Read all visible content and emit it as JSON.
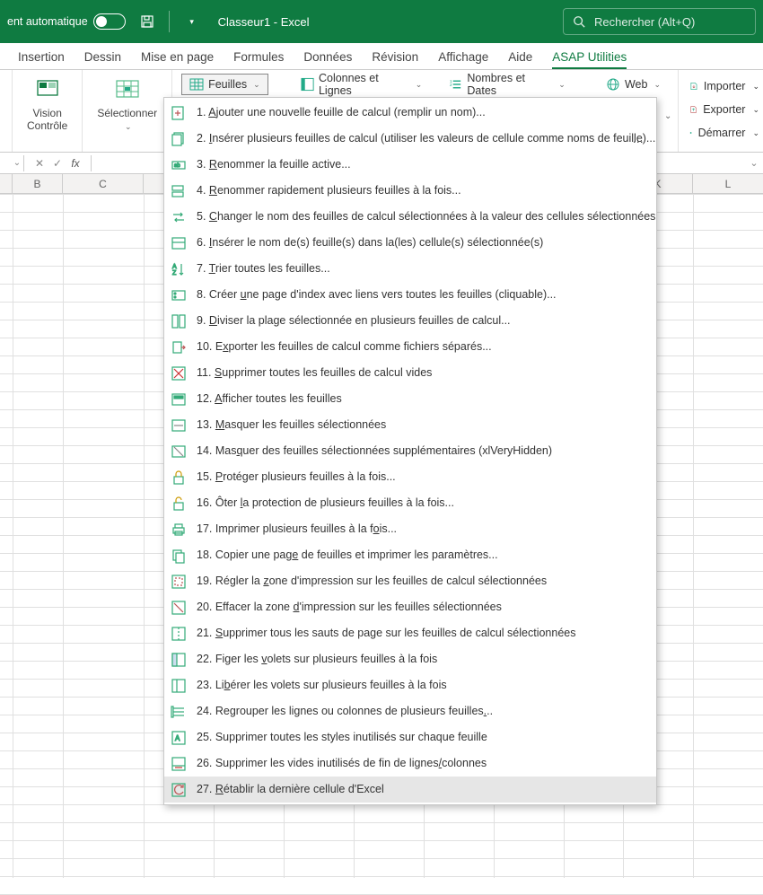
{
  "titlebar": {
    "autosave": "ent automatique",
    "doc_title": "Classeur1 - Excel",
    "search_placeholder": "Rechercher (Alt+Q)"
  },
  "tabs": [
    "Insertion",
    "Dessin",
    "Mise en page",
    "Formules",
    "Données",
    "Révision",
    "Affichage",
    "Aide",
    "ASAP Utilities"
  ],
  "active_tab": 8,
  "ribbon": {
    "vision": "Vision\nContrôle",
    "select": "Sélectionner",
    "feuilles": "Feuilles",
    "colonnes": "Colonnes et Lignes",
    "nombres": "Nombres et Dates",
    "web": "Web",
    "right": [
      {
        "icon": "import",
        "label": "Importer"
      },
      {
        "icon": "export",
        "label": "Exporter"
      },
      {
        "icon": "play",
        "label": "Démarrer"
      }
    ]
  },
  "columns": [
    "B",
    "C",
    "K",
    "L"
  ],
  "menu": {
    "hover_index": 26,
    "items": [
      {
        "icon": "sheet-plus",
        "n": "1",
        "u": "A",
        "pre": "",
        "post": "jouter une nouvelle feuille de calcul (remplir un nom)...",
        "ell": false
      },
      {
        "icon": "sheets",
        "n": "2",
        "u": "I",
        "pre": "",
        "post": "nsérer plusieurs feuilles de calcul (utiliser les valeurs de cellule comme noms de feuille)...",
        "ell": true
      },
      {
        "icon": "rename",
        "n": "3",
        "u": "R",
        "pre": "",
        "post": "enommer la feuille active..."
      },
      {
        "icon": "rename-all",
        "n": "4",
        "u": "R",
        "pre": "",
        "post": "enommer rapidement plusieurs feuilles à la fois..."
      },
      {
        "icon": "swap",
        "n": "5",
        "u": "C",
        "pre": "",
        "post": "hanger le nom des feuilles de calcul sélectionnées à la valeur des cellules sélectionnées"
      },
      {
        "icon": "insert-name",
        "n": "6",
        "u": "I",
        "pre": "",
        "post": "nsérer le nom de(s) feuille(s) dans la(les) cellule(s) sélectionnée(s)"
      },
      {
        "icon": "sort",
        "n": "7",
        "u": "T",
        "pre": "",
        "post": "rier toutes les feuilles..."
      },
      {
        "icon": "index",
        "n": "8",
        "u": "u",
        "pre": "Créer ",
        "post": "ne page d'index avec liens vers toutes les feuilles (cliquable)..."
      },
      {
        "icon": "split",
        "n": "9",
        "u": "D",
        "pre": "",
        "post": "iviser la plage sélectionnée en plusieurs feuilles de calcul..."
      },
      {
        "icon": "export-files",
        "n": "10",
        "u": "x",
        "pre": "E",
        "post": "porter les feuilles de calcul comme fichiers séparés..."
      },
      {
        "icon": "del-empty",
        "n": "11",
        "u": "S",
        "pre": "",
        "post": "upprimer toutes les feuilles de calcul vides"
      },
      {
        "icon": "show",
        "n": "12",
        "u": "A",
        "pre": "",
        "post": "fficher toutes les feuilles"
      },
      {
        "icon": "hide",
        "n": "13",
        "u": "M",
        "pre": "",
        "post": "asquer les feuilles sélectionnées"
      },
      {
        "icon": "veryhide",
        "n": "14",
        "u": "q",
        "pre": "Mas",
        "post": "uer des feuilles sélectionnées supplémentaires (xlVeryHidden)"
      },
      {
        "icon": "protect",
        "n": "15",
        "u": "P",
        "pre": "",
        "post": "rotéger plusieurs feuilles à la fois..."
      },
      {
        "icon": "unprotect",
        "n": "16",
        "u": "l",
        "pre": "Ôter ",
        "post": "a protection de plusieurs feuilles à la fois..."
      },
      {
        "icon": "print",
        "n": "17",
        "u": "o",
        "pre": "Imprimer plusieurs feuilles à la f",
        "post": "is..."
      },
      {
        "icon": "copy",
        "n": "18",
        "u": "e",
        "pre": "Copier une pag",
        "post": " de feuilles et imprimer les paramètres..."
      },
      {
        "icon": "area-set",
        "n": "19",
        "u": "z",
        "pre": "Régler la ",
        "post": "one d'impression sur les feuilles de calcul sélectionnées"
      },
      {
        "icon": "area-clear",
        "n": "20",
        "u": "d",
        "pre": "Effacer  la zone ",
        "post": "'impression sur les feuilles sélectionnées"
      },
      {
        "icon": "breaks",
        "n": "21",
        "u": "S",
        "pre": "",
        "post": "upprimer tous les sauts de page sur les feuilles de calcul sélectionnées"
      },
      {
        "icon": "freeze",
        "n": "22",
        "u": "v",
        "pre": "Figer les ",
        "post": "olets sur plusieurs feuilles à la fois"
      },
      {
        "icon": "unfreeze",
        "n": "23",
        "u": "b",
        "pre": "Li",
        "post": "érer les volets sur plusieurs feuilles à la fois"
      },
      {
        "icon": "group",
        "n": "24",
        "u": ".",
        "pre": "Regrouper les lignes ou colonnes de plusieurs feuilles",
        "post": ".."
      },
      {
        "icon": "styles",
        "n": "25",
        "u": "",
        "pre": "Supprimer toutes les  styles inutilisés sur chaque feuille",
        "post": ""
      },
      {
        "icon": "blanks",
        "n": "26",
        "u": "/",
        "pre": "Supprimer les vides inutilisés de fin de lignes",
        "post": "colonnes"
      },
      {
        "icon": "reset",
        "n": "27",
        "u": "R",
        "pre": "",
        "post": "établir la dernière cellule d'Excel"
      }
    ]
  }
}
